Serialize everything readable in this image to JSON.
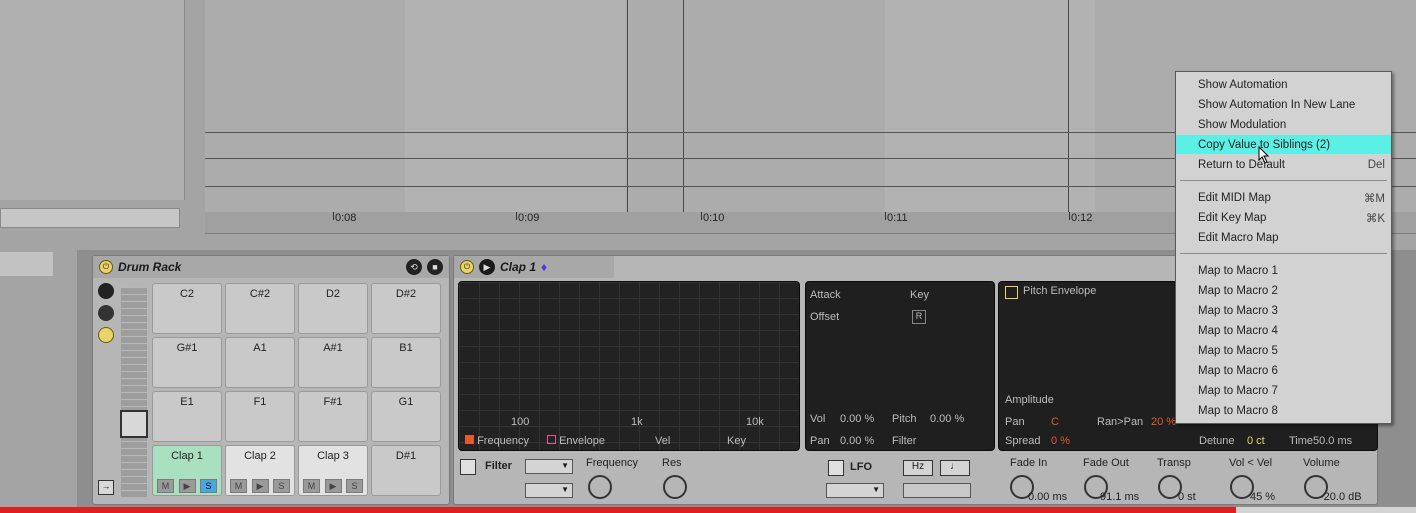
{
  "ruler": {
    "ticks": [
      "0:08",
      "0:09",
      "0:10",
      "0:11",
      "0:12"
    ]
  },
  "drum_rack": {
    "title": "Drum Rack",
    "pads": [
      {
        "label": "C2"
      },
      {
        "label": "C#2"
      },
      {
        "label": "D2"
      },
      {
        "label": "D#2"
      },
      {
        "label": "G#1"
      },
      {
        "label": "A1"
      },
      {
        "label": "A#1"
      },
      {
        "label": "B1"
      },
      {
        "label": "E1"
      },
      {
        "label": "F1"
      },
      {
        "label": "F#1"
      },
      {
        "label": "G1"
      },
      {
        "label": "Clap 1"
      },
      {
        "label": "Clap 2"
      },
      {
        "label": "Clap 3"
      },
      {
        "label": "D#1"
      }
    ],
    "pad_controls": [
      "M",
      "▶",
      "S"
    ]
  },
  "clap_device": {
    "title": "Clap 1",
    "spectrum": {
      "x_labels": [
        "100",
        "1k",
        "10k"
      ],
      "legend": [
        "Frequency",
        "Envelope",
        "Vel",
        "Key"
      ]
    },
    "sample": {
      "attack": "Attack",
      "key": "Key",
      "offset": "Offset",
      "key_btn": "R",
      "vol_label": "Vol",
      "vol_value": "0.00 %",
      "pitch_label": "Pitch",
      "pitch_value": "0.00 %",
      "pan_label": "Pan",
      "pan_value": "0.00 %",
      "filter_label": "Filter"
    },
    "pitch_env": {
      "title": "Pitch Envelope",
      "amplitude": "Amplitude",
      "pan_label": "Pan",
      "pan_value": "C",
      "ranpan_label": "Ran>Pan",
      "ranpan_value": "20 %",
      "spread_label": "Spread",
      "spread_value": "0 %",
      "detune_label": "Detune",
      "detune_value": "0 ct",
      "time_label": "Time",
      "time_value": "50.0 ms"
    },
    "bottom": {
      "filter": "Filter",
      "frequency": "Frequency",
      "res": "Res",
      "lfo": "LFO",
      "hz": "Hz",
      "note": "♩",
      "fade_in": "Fade In",
      "fade_in_value": "0.00 ms",
      "fade_out": "Fade Out",
      "fade_out_value": "91.1 ms",
      "transp": "Transp",
      "transp_value": "0 st",
      "vol_vel": "Vol < Vel",
      "vol_vel_value": "45 %",
      "volume": "Volume",
      "volume_value": "-20.0 dB"
    }
  },
  "context_menu": {
    "items": [
      {
        "label": "Show Automation",
        "shortcut": ""
      },
      {
        "label": "Show Automation In New Lane",
        "shortcut": ""
      },
      {
        "label": "Show Modulation",
        "shortcut": ""
      },
      {
        "label": "Copy Value to Siblings (2)",
        "shortcut": ""
      },
      {
        "label": "Return to Default",
        "shortcut": "Del"
      },
      {
        "label": "Edit MIDI Map",
        "shortcut": "⌘M"
      },
      {
        "label": "Edit Key Map",
        "shortcut": "⌘K"
      },
      {
        "label": "Edit Macro Map",
        "shortcut": ""
      },
      {
        "label": "Map to Macro 1",
        "shortcut": ""
      },
      {
        "label": "Map to Macro 2",
        "shortcut": ""
      },
      {
        "label": "Map to Macro 3",
        "shortcut": ""
      },
      {
        "label": "Map to Macro 4",
        "shortcut": ""
      },
      {
        "label": "Map to Macro 5",
        "shortcut": ""
      },
      {
        "label": "Map to Macro 6",
        "shortcut": ""
      },
      {
        "label": "Map to Macro 7",
        "shortcut": ""
      },
      {
        "label": "Map to Macro 8",
        "shortcut": ""
      }
    ]
  },
  "colors": {
    "highlight": "#5af0e6",
    "power": "#e8d46a",
    "solo": "#4aa6e0",
    "progress": "#e02020"
  },
  "progress": {
    "fraction": 0.873
  }
}
